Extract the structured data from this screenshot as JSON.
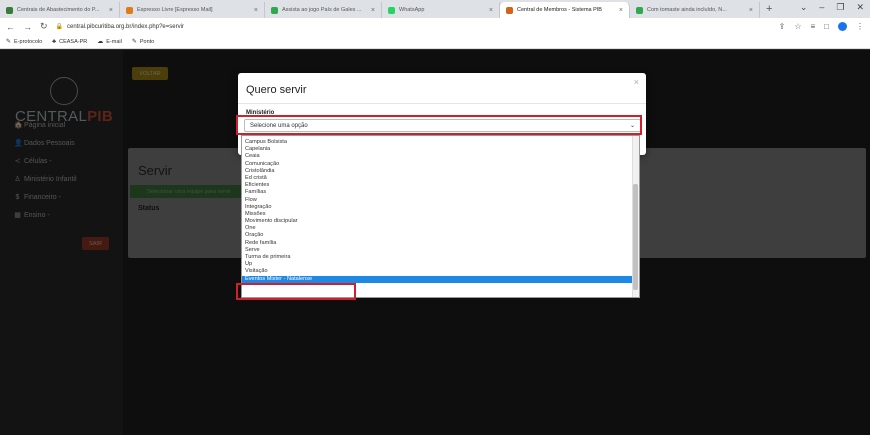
{
  "browser": {
    "tabs": [
      {
        "title": "Centrais de Abastecimento do P...",
        "favicon_color": "#3a7a3a",
        "active": false
      },
      {
        "title": "Espresso Livre [Espresso Mail]",
        "favicon_color": "#e07a1a",
        "active": false
      },
      {
        "title": "Assista ao jogo País de Gales ...",
        "favicon_color": "#2fa84f",
        "active": false
      },
      {
        "title": "WhatsApp",
        "favicon_color": "#25d366",
        "active": false
      },
      {
        "title": "Central de Membros - Sistema PIB",
        "favicon_color": "#d1631a",
        "active": true
      },
      {
        "title": "Com tomaste ainda incluído, N...",
        "favicon_color": "#2fa84f",
        "active": false
      }
    ],
    "new_tab": "+",
    "url": "central.pibcuritiba.org.br/index.php?e=servir",
    "bookmarks": [
      "E-protocolo",
      "CEASA-PR",
      "E-mail",
      "Ponto"
    ]
  },
  "sidebar": {
    "logo_text_a": "CENTRAL",
    "logo_text_b": "PIB",
    "items": [
      {
        "label": "Página inicial",
        "icon": "home-icon",
        "glyph": "🏠"
      },
      {
        "label": "Dados Pessoais",
        "icon": "user-icon",
        "glyph": "👤"
      },
      {
        "label": "Células -",
        "icon": "share-icon",
        "glyph": "≺"
      },
      {
        "label": "Ministério Infantil",
        "icon": "child-icon",
        "glyph": "♙"
      },
      {
        "label": "Financeiro -",
        "icon": "dollar-icon",
        "glyph": "$"
      },
      {
        "label": "Ensino -",
        "icon": "book-icon",
        "glyph": "▦"
      }
    ],
    "logout_label": "SAIR"
  },
  "content": {
    "back_label": "VOLTAR",
    "card_title": "Servir",
    "select_team_label": "Selecionar uma equipe para servir",
    "status_label": "Status"
  },
  "modal": {
    "title": "Quero servir",
    "close_glyph": "×",
    "field_label": "Ministério",
    "select_value": "Selecione uma opção"
  },
  "dropdown": {
    "options": [
      "Campus Bolsista",
      "Capelania",
      "Ceaia",
      "Comunicação",
      "Cristolândia",
      "Ed cristã",
      "Eficientes",
      "Famílias",
      "Flow",
      "Integração",
      "Missões",
      "Movimento discipular",
      "One",
      "Oração",
      "Rede família",
      "Serve",
      "Turma de primeira",
      "Up",
      "Visitação",
      "Eventos Mister - Natalense"
    ],
    "selected": "Eventos Mister - Natalense"
  },
  "colors": {
    "highlight": "#d0202b",
    "selected_option": "#1e88e5",
    "back_button": "#a68a19",
    "logout_button": "#9a3a2a",
    "team_button": "#3f7a3f"
  }
}
